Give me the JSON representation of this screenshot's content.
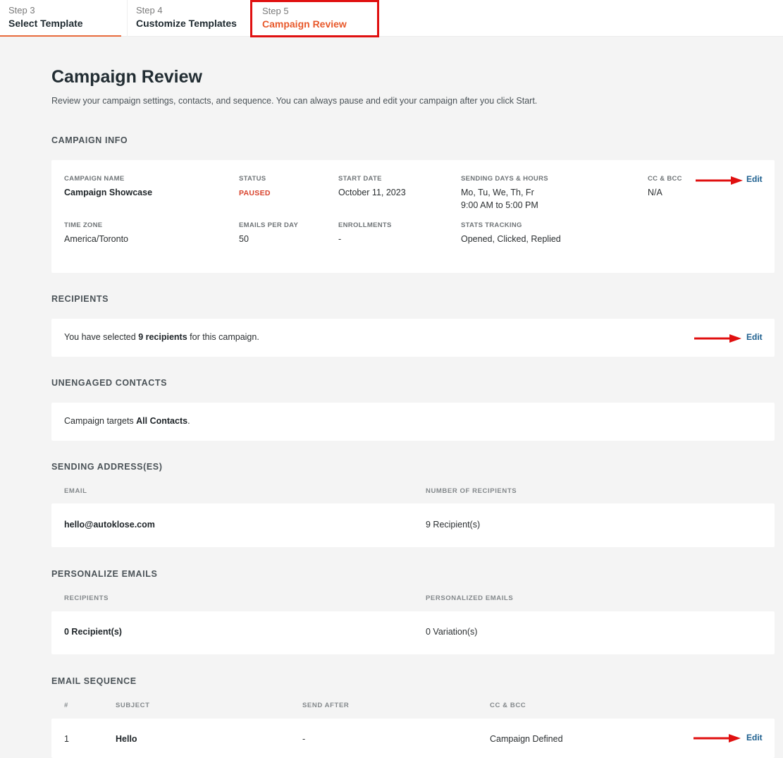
{
  "steps": [
    {
      "num": "Step 3",
      "name": "Select Template"
    },
    {
      "num": "Step 4",
      "name": "Customize Templates"
    },
    {
      "num": "Step 5",
      "name": "Campaign Review"
    }
  ],
  "page": {
    "title": "Campaign Review",
    "description": "Review your campaign settings, contacts, and sequence. You can always pause and edit your campaign after you click Start."
  },
  "campaign_info": {
    "heading": "CAMPAIGN INFO",
    "edit": "Edit",
    "fields": {
      "name_label": "CAMPAIGN NAME",
      "name_value": "Campaign Showcase",
      "status_label": "STATUS",
      "status_value": "PAUSED",
      "start_label": "START DATE",
      "start_value": "October 11, 2023",
      "days_label": "SENDING DAYS & HOURS",
      "days_value": "Mo, Tu, We, Th, Fr",
      "hours_value": "9:00 AM to 5:00 PM",
      "cc_label": "CC & BCC",
      "cc_value": "N/A",
      "tz_label": "TIME ZONE",
      "tz_value": "America/Toronto",
      "epd_label": "EMAILS PER DAY",
      "epd_value": "50",
      "enroll_label": "ENROLLMENTS",
      "enroll_value": "-",
      "stats_label": "STATS TRACKING",
      "stats_value": "Opened, Clicked, Replied"
    }
  },
  "recipients": {
    "heading": "RECIPIENTS",
    "text_pre": "You have selected ",
    "text_bold": "9 recipients",
    "text_post": " for this campaign.",
    "edit": "Edit"
  },
  "unengaged": {
    "heading": "UNENGAGED CONTACTS",
    "text_pre": "Campaign targets ",
    "text_bold": "All Contacts",
    "text_post": "."
  },
  "sending": {
    "heading": "SENDING ADDRESS(ES)",
    "col_email": "EMAIL",
    "col_count": "NUMBER OF RECIPIENTS",
    "email": "hello@autoklose.com",
    "count": "9 Recipient(s)"
  },
  "personalize": {
    "heading": "PERSONALIZE EMAILS",
    "col_recipients": "RECIPIENTS",
    "col_personalized": "PERSONALIZED EMAILS",
    "recipients": "0 Recipient(s)",
    "personalized": "0 Variation(s)"
  },
  "sequence": {
    "heading": "EMAIL SEQUENCE",
    "col_num": "#",
    "col_subject": "SUBJECT",
    "col_send_after": "SEND AFTER",
    "col_cc": "CC & BCC",
    "rows": [
      {
        "num": "1",
        "subject": "Hello",
        "send_after": "-",
        "cc": "Campaign Defined",
        "edit": "Edit"
      }
    ]
  },
  "colors": {
    "accent": "#e8592b",
    "highlight_box": "#e01010",
    "link": "#1d5f8f",
    "status_paused": "#d8412a"
  }
}
